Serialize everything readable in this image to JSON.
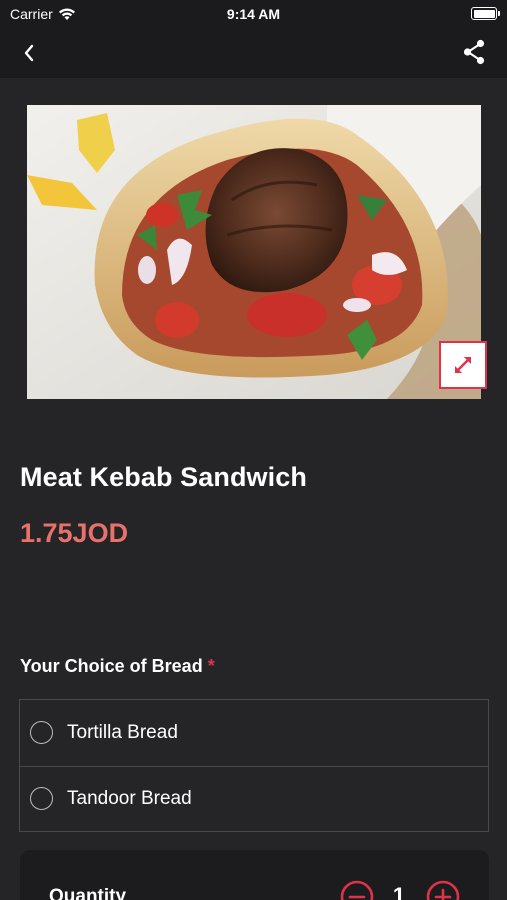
{
  "status_bar": {
    "carrier": "Carrier",
    "time": "9:14 AM",
    "icons": [
      "wifi-icon",
      "battery-icon"
    ]
  },
  "nav": {
    "back_icon": "chevron-left-icon",
    "share_icon": "share-icon"
  },
  "product": {
    "image_alt": "Meat kebab wrapped in flatbread with tomato, onion and parsley",
    "expand_icon": "expand-arrows-icon",
    "title": "Meat Kebab Sandwich",
    "price": "1.75JOD"
  },
  "bread_choice": {
    "label": "Your Choice of Bread",
    "required_mark": "*",
    "options": [
      {
        "label": "Tortilla Bread",
        "selected": false
      },
      {
        "label": "Tandoor Bread",
        "selected": false
      }
    ]
  },
  "quantity": {
    "label": "Quantity",
    "value": "1",
    "minus_icon": "minus-circle-icon",
    "plus_icon": "plus-circle-icon"
  },
  "colors": {
    "background": "#252528",
    "bar": "#1b1b1d",
    "price": "#e8716c",
    "accent": "#e0334a"
  }
}
